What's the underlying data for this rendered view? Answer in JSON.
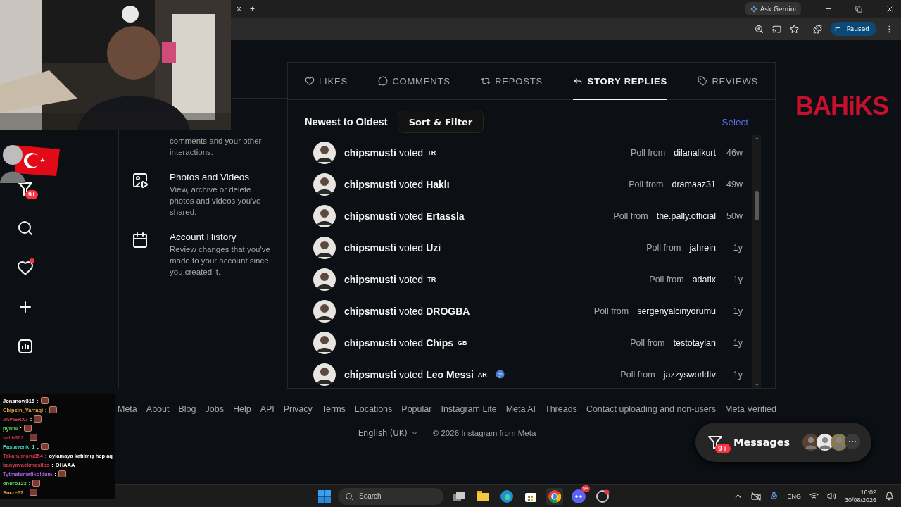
{
  "browser": {
    "tab_close": "×",
    "new_tab": "+",
    "gemini": "Ask Gemini",
    "profile_initial": "m",
    "profile_status": "Paused"
  },
  "nav": {
    "messages_badge": "9+"
  },
  "settings": {
    "items": [
      {
        "kind": "partial",
        "description": "comments and your other interactions."
      },
      {
        "kind": "photos",
        "title": "Photos and Videos",
        "description": "View, archive or delete photos and videos you've shared."
      },
      {
        "kind": "history",
        "title": "Account History",
        "description": "Review changes that you've made to your account since you created it."
      }
    ]
  },
  "tabs": [
    {
      "kind": "likes",
      "label": "LIKES",
      "selected": false
    },
    {
      "kind": "comments",
      "label": "COMMENTS",
      "selected": false
    },
    {
      "kind": "reposts",
      "label": "REPOSTS",
      "selected": false
    },
    {
      "kind": "replies",
      "label": "STORY REPLIES",
      "selected": true
    },
    {
      "kind": "reviews",
      "label": "REVIEWS",
      "selected": false
    }
  ],
  "sort": {
    "order": "Newest to Oldest",
    "button": "Sort & Filter",
    "select": "Select"
  },
  "activity": [
    {
      "user": "chipsmusti",
      "verb": "voted",
      "flag": "TR",
      "globe": false,
      "poll_label": "Poll from",
      "poll_author": "dilanalikurt",
      "time": "46w"
    },
    {
      "user": "chipsmusti",
      "verb": "voted",
      "choice": "Haklı",
      "globe": false,
      "poll_label": "Poll from",
      "poll_author": "dramaaz31",
      "time": "49w"
    },
    {
      "user": "chipsmusti",
      "verb": "voted",
      "choice": "Ertassla",
      "globe": false,
      "poll_label": "Poll from",
      "poll_author": "the.pally.official",
      "time": "50w"
    },
    {
      "user": "chipsmusti",
      "verb": "voted",
      "choice": "Uzi",
      "globe": false,
      "poll_label": "Poll from",
      "poll_author": "jahrein",
      "time": "1y"
    },
    {
      "user": "chipsmusti",
      "verb": "voted",
      "flag": "TR",
      "globe": false,
      "poll_label": "Poll from",
      "poll_author": "adatix",
      "time": "1y"
    },
    {
      "user": "chipsmusti",
      "verb": "voted",
      "choice": "DROGBA",
      "globe": false,
      "poll_label": "Poll from",
      "poll_author": "sergenyalcinyorumu",
      "time": "1y"
    },
    {
      "user": "chipsmusti",
      "verb": "voted",
      "choice": "Chips",
      "flag": "GB",
      "globe": false,
      "poll_label": "Poll from",
      "poll_author": "testotaylan",
      "time": "1y"
    },
    {
      "user": "chipsmusti",
      "verb": "voted",
      "choice": "Leo Messi",
      "flag": "AR",
      "globe": true,
      "poll_label": "Poll from",
      "poll_author": "jazzysworldtv",
      "time": "1y"
    }
  ],
  "footer": {
    "links": [
      "Meta",
      "About",
      "Blog",
      "Jobs",
      "Help",
      "API",
      "Privacy",
      "Terms",
      "Locations",
      "Popular",
      "Instagram Lite",
      "Meta AI",
      "Threads",
      "Contact uploading and non-users",
      "Meta Verified"
    ],
    "language": "English (UK)",
    "copyright": "© 2026 Instagram from Meta"
  },
  "messages": {
    "badge": "9+",
    "label": "Messages",
    "more": "···"
  },
  "overlay": {
    "logo": "BAHiKS"
  },
  "chat": [
    {
      "user": "Jonsnow316",
      "color": "#ffffff",
      "separator": ":",
      "emote": true
    },
    {
      "user": "Chipsin_Yarragi",
      "color": "#e8a33a",
      "separator": ":",
      "emote": true
    },
    {
      "user": "JAVIERX7",
      "color": "#d2415f",
      "separator": ":",
      "emote": true
    },
    {
      "user": "pyhtN",
      "color": "#5fd35f",
      "separator": ":",
      "emote": true
    },
    {
      "user": "salih362",
      "color": "#c8304f",
      "separator": ":",
      "emote": true
    },
    {
      "user": "Pastavenk_1",
      "color": "#3fe0c0",
      "separator": ":",
      "emote": true
    },
    {
      "user": "Takanumoru354",
      "color": "#d03a4a",
      "separator": ":",
      "text": "oylamaya katılmış hep aq",
      "emote": false
    },
    {
      "user": "banyavackmasilbs",
      "color": "#d03a4a",
      "separator": ":",
      "text": "OHAAA",
      "emote": false
    },
    {
      "user": "Tytmatematikoldum",
      "color": "#a05ee0",
      "separator": ":",
      "emote": true
    },
    {
      "user": "onuro123",
      "color": "#5fd35f",
      "separator": ":",
      "emote": true
    },
    {
      "user": "Sucre67",
      "color": "#e8a33a",
      "separator": ":",
      "emote": true
    }
  ],
  "taskbar": {
    "search": "Search",
    "discord_badge": "9+",
    "language": "ENG",
    "time": "16:02",
    "date": "30/08/2026"
  }
}
